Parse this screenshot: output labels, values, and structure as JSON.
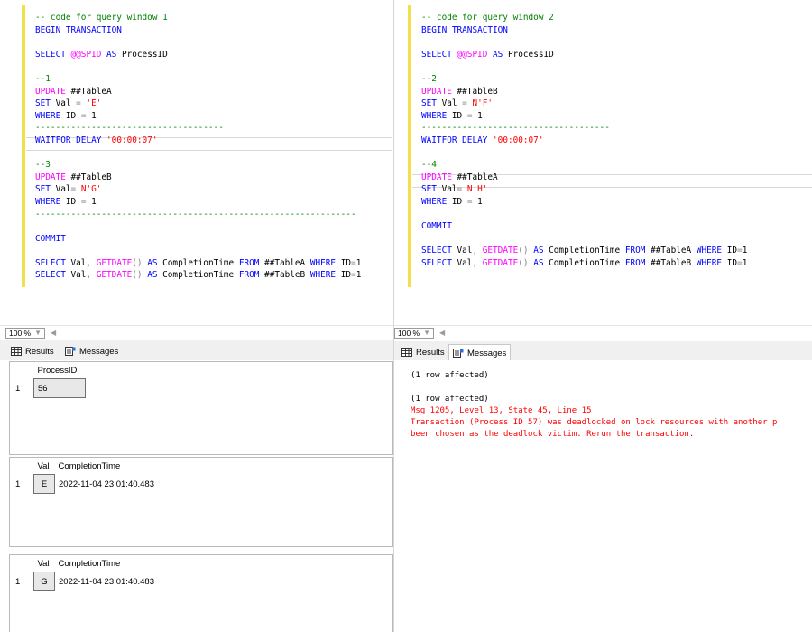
{
  "left": {
    "code_lines": [
      [
        {
          "t": "-- code for query window 1",
          "c": "c"
        }
      ],
      [
        {
          "t": "BEGIN TRANSACTION",
          "c": "k"
        }
      ],
      [],
      [
        {
          "t": "SELECT ",
          "c": "k"
        },
        {
          "t": "@@SPID",
          "c": "p"
        },
        {
          "t": " AS ",
          "c": "k"
        },
        {
          "t": "ProcessID",
          "c": "t"
        }
      ],
      [],
      [
        {
          "t": "--1",
          "c": "c"
        }
      ],
      [
        {
          "t": "UPDATE ",
          "c": "p"
        },
        {
          "t": "##TableA",
          "c": "t"
        }
      ],
      [
        {
          "t": "SET ",
          "c": "k"
        },
        {
          "t": "Val ",
          "c": "t"
        },
        {
          "t": "= ",
          "c": "g"
        },
        {
          "t": "'E'",
          "c": "s"
        }
      ],
      [
        {
          "t": "WHERE ",
          "c": "k"
        },
        {
          "t": "ID ",
          "c": "t"
        },
        {
          "t": "= ",
          "c": "g"
        },
        {
          "t": "1",
          "c": "t"
        }
      ],
      [
        {
          "t": "-------------------------------------",
          "c": "c"
        }
      ],
      [
        {
          "t": "WAITFOR DELAY ",
          "c": "k"
        },
        {
          "t": "'00:00:07'",
          "c": "s"
        }
      ],
      [],
      [
        {
          "t": "--3",
          "c": "c"
        }
      ],
      [
        {
          "t": "UPDATE ",
          "c": "p"
        },
        {
          "t": "##TableB",
          "c": "t"
        }
      ],
      [
        {
          "t": "SET ",
          "c": "k"
        },
        {
          "t": "Val",
          "c": "t"
        },
        {
          "t": "= ",
          "c": "g"
        },
        {
          "t": "N'G'",
          "c": "s"
        }
      ],
      [
        {
          "t": "WHERE ",
          "c": "k"
        },
        {
          "t": "ID ",
          "c": "t"
        },
        {
          "t": "= ",
          "c": "g"
        },
        {
          "t": "1",
          "c": "t"
        }
      ],
      [
        {
          "t": "---------------------------------------------------------------",
          "c": "c"
        }
      ],
      [],
      [
        {
          "t": "COMMIT",
          "c": "k"
        }
      ],
      [],
      [
        {
          "t": "SELECT ",
          "c": "k"
        },
        {
          "t": "Val",
          "c": "t"
        },
        {
          "t": ", ",
          "c": "g"
        },
        {
          "t": "GETDATE",
          "c": "f"
        },
        {
          "t": "() ",
          "c": "g"
        },
        {
          "t": "AS ",
          "c": "k"
        },
        {
          "t": "CompletionTime ",
          "c": "t"
        },
        {
          "t": "FROM ",
          "c": "k"
        },
        {
          "t": "##TableA ",
          "c": "t"
        },
        {
          "t": "WHERE ",
          "c": "k"
        },
        {
          "t": "ID",
          "c": "t"
        },
        {
          "t": "=",
          "c": "g"
        },
        {
          "t": "1",
          "c": "t"
        }
      ],
      [
        {
          "t": "SELECT ",
          "c": "k"
        },
        {
          "t": "Val",
          "c": "t"
        },
        {
          "t": ", ",
          "c": "g"
        },
        {
          "t": "GETDATE",
          "c": "f"
        },
        {
          "t": "() ",
          "c": "g"
        },
        {
          "t": "AS ",
          "c": "k"
        },
        {
          "t": "CompletionTime ",
          "c": "t"
        },
        {
          "t": "FROM ",
          "c": "k"
        },
        {
          "t": "##TableB ",
          "c": "t"
        },
        {
          "t": "WHERE ",
          "c": "k"
        },
        {
          "t": "ID",
          "c": "t"
        },
        {
          "t": "=",
          "c": "g"
        },
        {
          "t": "1",
          "c": "t"
        }
      ]
    ],
    "zoom": "100 %",
    "tabs": {
      "results": "Results",
      "messages": "Messages"
    },
    "grid1": {
      "header": "ProcessID",
      "rownum": "1",
      "value": "56"
    },
    "grid2": {
      "col1": "Val",
      "col2": "CompletionTime",
      "rownum": "1",
      "val": "E",
      "time": "2022-11-04 23:01:40.483"
    },
    "grid3": {
      "col1": "Val",
      "col2": "CompletionTime",
      "rownum": "1",
      "val": "G",
      "time": "2022-11-04 23:01:40.483"
    }
  },
  "right": {
    "code_lines": [
      [
        {
          "t": "-- code for query window 2",
          "c": "c"
        }
      ],
      [
        {
          "t": "BEGIN TRANSACTION",
          "c": "k"
        }
      ],
      [],
      [
        {
          "t": "SELECT ",
          "c": "k"
        },
        {
          "t": "@@SPID",
          "c": "p"
        },
        {
          "t": " AS ",
          "c": "k"
        },
        {
          "t": "ProcessID",
          "c": "t"
        }
      ],
      [],
      [
        {
          "t": "--2",
          "c": "c"
        }
      ],
      [
        {
          "t": "UPDATE ",
          "c": "p"
        },
        {
          "t": "##TableB",
          "c": "t"
        }
      ],
      [
        {
          "t": "SET ",
          "c": "k"
        },
        {
          "t": "Val ",
          "c": "t"
        },
        {
          "t": "= ",
          "c": "g"
        },
        {
          "t": "N'F'",
          "c": "s"
        }
      ],
      [
        {
          "t": "WHERE ",
          "c": "k"
        },
        {
          "t": "ID ",
          "c": "t"
        },
        {
          "t": "= ",
          "c": "g"
        },
        {
          "t": "1",
          "c": "t"
        }
      ],
      [
        {
          "t": "-------------------------------------",
          "c": "c"
        }
      ],
      [
        {
          "t": "WAITFOR DELAY ",
          "c": "k"
        },
        {
          "t": "'00:00:07'",
          "c": "s"
        }
      ],
      [],
      [
        {
          "t": "--4",
          "c": "c"
        }
      ],
      [
        {
          "t": "UPDATE ",
          "c": "p"
        },
        {
          "t": "##TableA",
          "c": "t"
        }
      ],
      [
        {
          "t": "SET ",
          "c": "k"
        },
        {
          "t": "Val",
          "c": "t"
        },
        {
          "t": "= ",
          "c": "g"
        },
        {
          "t": "N'H'",
          "c": "s"
        }
      ],
      [
        {
          "t": "WHERE ",
          "c": "k"
        },
        {
          "t": "ID ",
          "c": "t"
        },
        {
          "t": "= ",
          "c": "g"
        },
        {
          "t": "1",
          "c": "t"
        }
      ],
      [],
      [
        {
          "t": "COMMIT",
          "c": "k"
        }
      ],
      [],
      [
        {
          "t": "SELECT ",
          "c": "k"
        },
        {
          "t": "Val",
          "c": "t"
        },
        {
          "t": ", ",
          "c": "g"
        },
        {
          "t": "GETDATE",
          "c": "f"
        },
        {
          "t": "() ",
          "c": "g"
        },
        {
          "t": "AS ",
          "c": "k"
        },
        {
          "t": "CompletionTime ",
          "c": "t"
        },
        {
          "t": "FROM ",
          "c": "k"
        },
        {
          "t": "##TableA ",
          "c": "t"
        },
        {
          "t": "WHERE ",
          "c": "k"
        },
        {
          "t": "ID",
          "c": "t"
        },
        {
          "t": "=",
          "c": "g"
        },
        {
          "t": "1",
          "c": "t"
        }
      ],
      [
        {
          "t": "SELECT ",
          "c": "k"
        },
        {
          "t": "Val",
          "c": "t"
        },
        {
          "t": ", ",
          "c": "g"
        },
        {
          "t": "GETDATE",
          "c": "f"
        },
        {
          "t": "() ",
          "c": "g"
        },
        {
          "t": "AS ",
          "c": "k"
        },
        {
          "t": "CompletionTime ",
          "c": "t"
        },
        {
          "t": "FROM ",
          "c": "k"
        },
        {
          "t": "##TableB ",
          "c": "t"
        },
        {
          "t": "WHERE ",
          "c": "k"
        },
        {
          "t": "ID",
          "c": "t"
        },
        {
          "t": "=",
          "c": "g"
        },
        {
          "t": "1",
          "c": "t"
        }
      ]
    ],
    "zoom": "100 %",
    "tabs": {
      "results": "Results",
      "messages": "Messages"
    },
    "messages": {
      "line1": "(1 row affected)",
      "line2": "(1 row affected)",
      "error1": "Msg 1205, Level 13, State 45, Line 15",
      "error2": "Transaction (Process ID 57) was deadlocked on lock resources with another p",
      "error3": "been chosen as the deadlock victim. Rerun the transaction."
    }
  },
  "colors": {
    "comment": "#008000",
    "keyword": "#0000ff",
    "system": "#ff00ff",
    "string": "#ff0000",
    "change_bar": "#f1e049",
    "error": "#ff0000"
  }
}
